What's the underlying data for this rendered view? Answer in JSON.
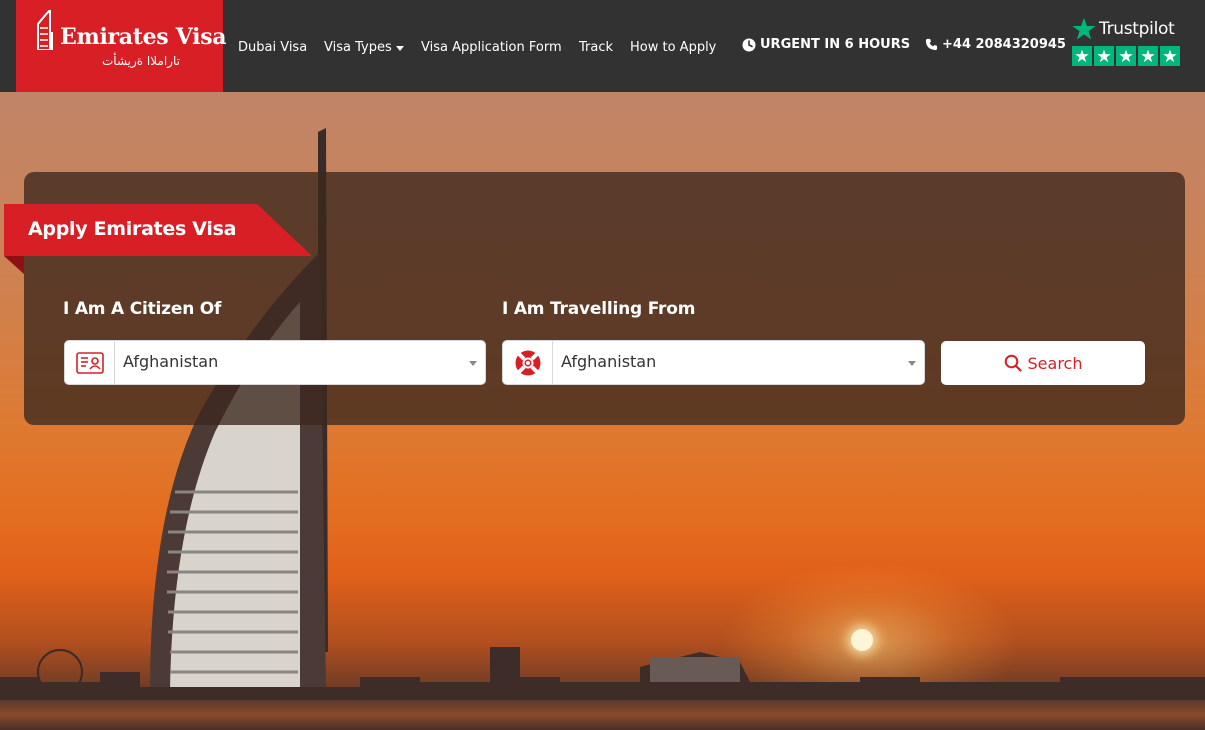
{
  "brand": {
    "name": "Emirates Visa",
    "name_arabic": "تاراملاا ةريشأت",
    "color": "#d81f26"
  },
  "nav": {
    "dubai_visa": "Dubai Visa",
    "visa_types": "Visa Types",
    "application_form": "Visa Application Form",
    "track": "Track",
    "how_to_apply": "How to Apply"
  },
  "header": {
    "urgent": "URGENT IN 6 HOURS",
    "phone": "+44 2084320945",
    "clock_icon": "clock-icon",
    "phone_icon": "phone-icon"
  },
  "trustpilot": {
    "name": "Trustpilot",
    "stars": 5,
    "color": "#00b67a"
  },
  "form": {
    "ribbon_title": "Apply Emirates Visa",
    "citizen_label": "I Am A Citizen Of",
    "citizen_value": "Afghanistan",
    "citizen_icon": "id-card-icon",
    "travel_label": "I Am Travelling From",
    "travel_value": "Afghanistan",
    "travel_icon": "lifebuoy-icon",
    "search_label": "Search",
    "search_icon": "search-icon"
  }
}
